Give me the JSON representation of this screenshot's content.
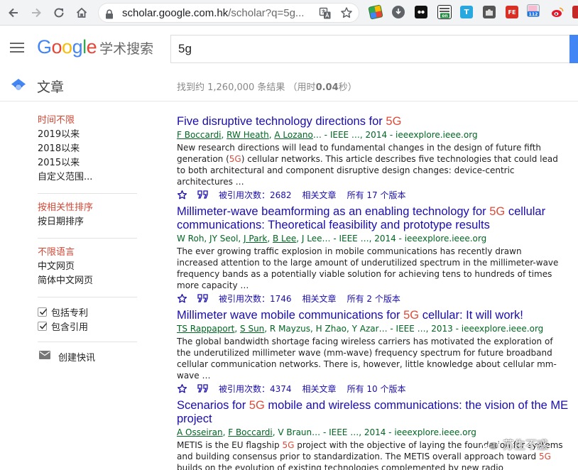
{
  "browser": {
    "url_host": "scholar.google.com.hk",
    "url_path": "/scholar?q=5g..."
  },
  "header": {
    "logo_letters": [
      "G",
      "o",
      "o",
      "g",
      "l",
      "e"
    ],
    "logo_colors": [
      "#4285f4",
      "#ea4335",
      "#fbbc05",
      "#4285f4",
      "#34a853",
      "#ea4335"
    ],
    "logo_sub": "学术搜索",
    "query": "5g"
  },
  "subheader": {
    "section": "文章",
    "stats_prefix": "找到约 1,260,000 条结果 （用时",
    "stats_time": "0.04",
    "stats_suffix": "秒）"
  },
  "sidebar": {
    "time": [
      "时间不限",
      "2019以来",
      "2018以来",
      "2015以来",
      "自定义范围..."
    ],
    "sort": [
      "按相关性排序",
      "按日期排序"
    ],
    "lang": [
      "不限语言",
      "中文网页",
      "简体中文网页"
    ],
    "checks": [
      "包括专利",
      "包含引用"
    ],
    "alert": "创建快讯"
  },
  "results": [
    {
      "title_pre": "Five disruptive technology directions for ",
      "title_hl": "5G",
      "title_post": "",
      "title_line2": "",
      "authors_linked": [
        "F Boccardi",
        "RW Heath",
        "A Lozano"
      ],
      "authors_plain": "",
      "source": "… - IEEE …, 2014 - ieeexplore.ieee.org",
      "snippet_a": "New research directions will lead to fundamental changes in the design of future fifth generation (",
      "snippet_hl": "5G",
      "snippet_b": ") cellular networks. This article describes five technologies that could lead to both architectural and component disruptive design changes: device-centric architectures …",
      "cited": "被引用次数：2682",
      "related": "相关文章",
      "versions": "所有 17 个版本"
    },
    {
      "title_pre": "Millimeter-wave beamforming as an enabling technology for ",
      "title_hl": "5G",
      "title_post": " cellular",
      "title_line2": "communications: Theoretical feasibility and prototype results",
      "authors_plain_pre": "W Roh, JY Seol, ",
      "authors_linked": [
        "J Park",
        "B Lee"
      ],
      "authors_plain": ", J Lee… - IEEE …, 2014 - ieeexplore.ieee.org",
      "snippet_a": "The ever growing traffic explosion in mobile communications has recently drawn increased attention to the large amount of underutilized spectrum in the millimeter-wave frequency bands as a potentially viable solution for achieving tens to hundreds of times more capacity …",
      "snippet_hl": "",
      "snippet_b": "",
      "cited": "被引用次数：1746",
      "related": "相关文章",
      "versions": "所有 2 个版本"
    },
    {
      "title_pre": "Millimeter wave mobile communications for ",
      "title_hl": "5G",
      "title_post": " cellular: It will work!",
      "title_line2": "",
      "authors_linked": [
        "TS Rappaport",
        "S Sun"
      ],
      "authors_plain": ", R Mayzus, H Zhao, Y Azar… - IEEE …, 2013 - ieeexplore.ieee.org",
      "snippet_a": "The global bandwidth shortage facing wireless carriers has motivated the exploration of the underutilized millimeter wave (mm-wave) frequency spectrum for future broadband cellular communication networks. There is, however, little knowledge about cellular mm-wave …",
      "snippet_hl": "",
      "snippet_b": "",
      "cited": "被引用次数：4374",
      "related": "相关文章",
      "versions": "所有 10 个版本"
    },
    {
      "title_pre": "Scenarios for ",
      "title_hl": "5G",
      "title_post": " mobile and wireless communications: the vision of the ME",
      "title_line2": "project",
      "authors_linked": [
        "A Osseiran",
        "F Boccardi"
      ],
      "authors_plain": ", V Braun… - IEEE …, 2014 - ieeexplore.ieee.org",
      "snippet_a": "METIS is the EU flagship ",
      "snippet_hl": "5G",
      "snippet_b": " project with the objective of laying the foundation for systems and building consensus prior to standardization. The METIS overall approach toward ",
      "snippet_hl2": "5G",
      "snippet_c": " builds on the evolution of existing technologies complemented by new radio",
      "cited": "",
      "related": "",
      "versions": ""
    }
  ],
  "watermark": "苏生不惑"
}
